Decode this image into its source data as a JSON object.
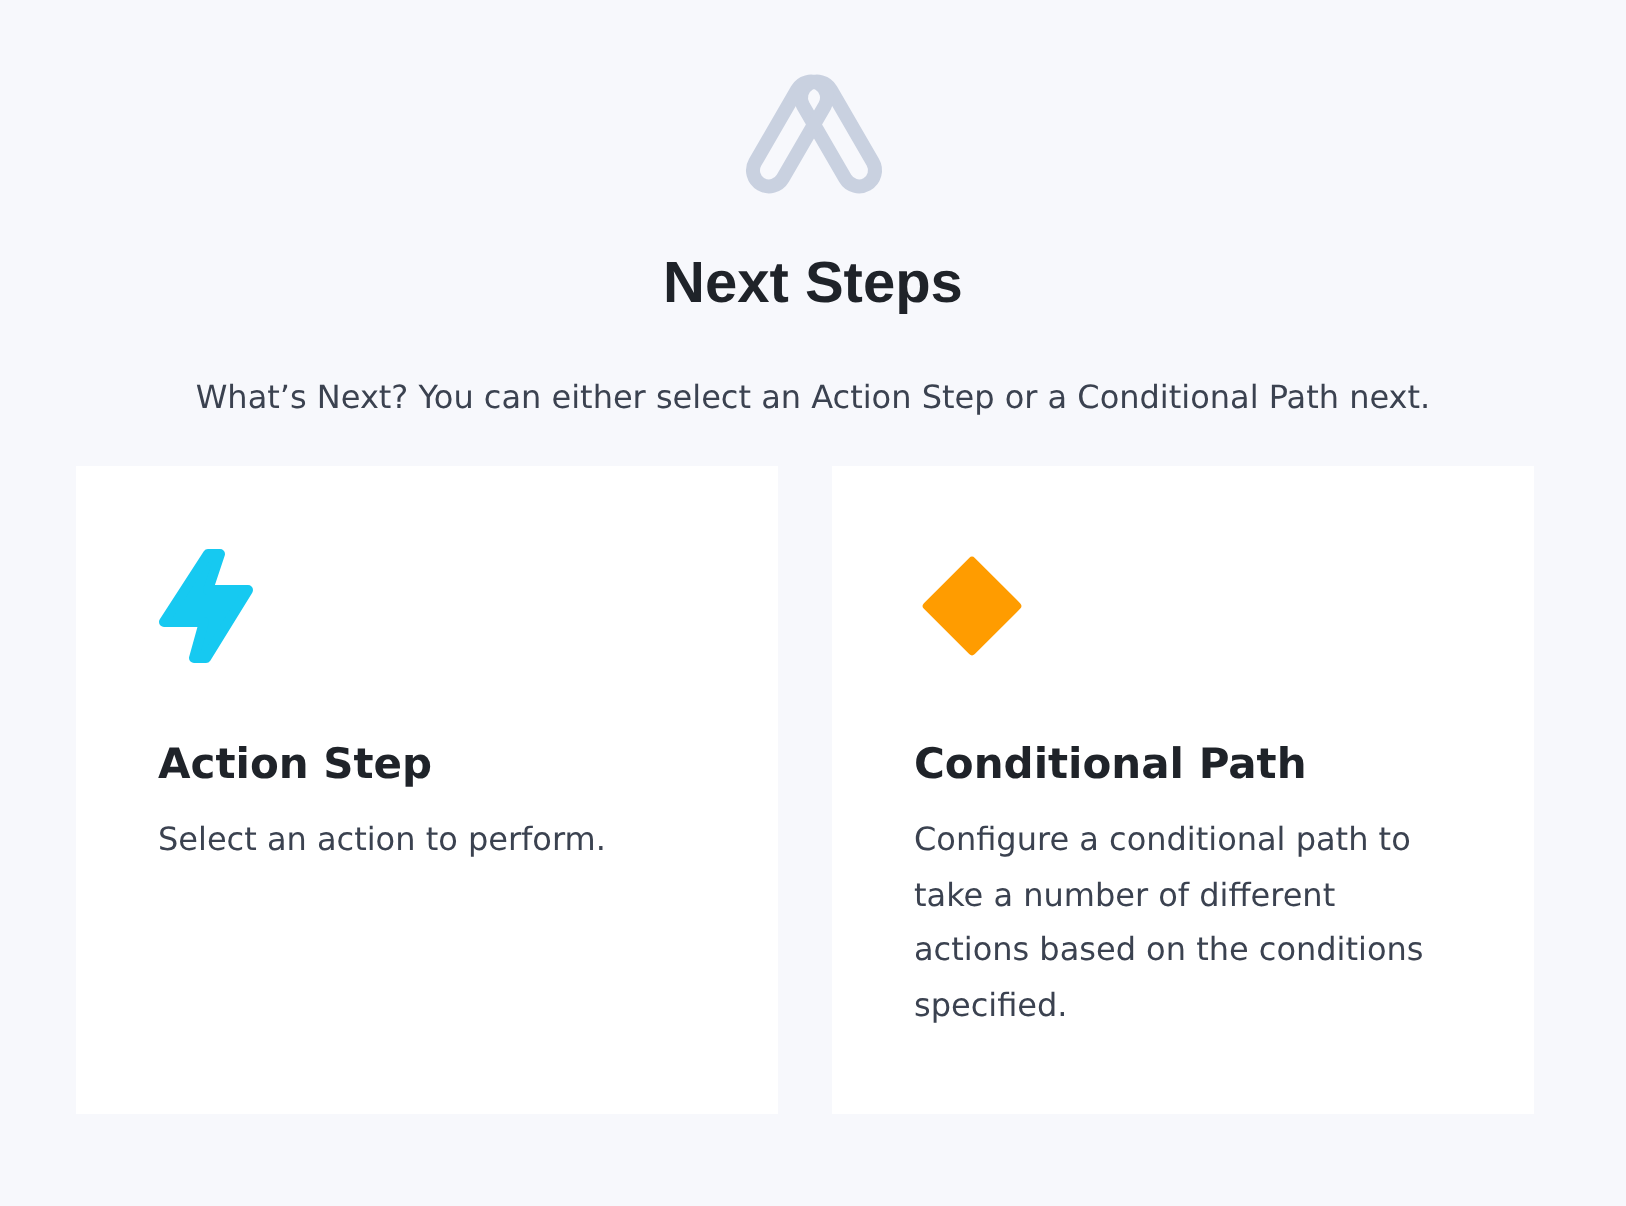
{
  "header": {
    "title": "Next Steps",
    "subtitle": "What’s Next? You can either select an Action Step or a Conditional Path next."
  },
  "options": [
    {
      "kind": "action",
      "title": "Action Step",
      "description": "Select an action to perform."
    },
    {
      "kind": "condition",
      "title": "Conditional Path",
      "description": "Configure a conditional path to take a number of different actions based on the conditions specified."
    }
  ]
}
